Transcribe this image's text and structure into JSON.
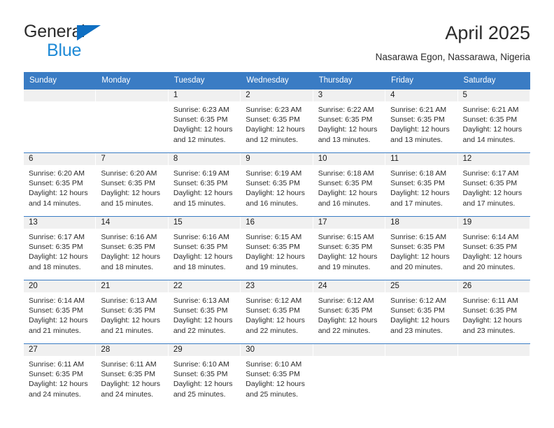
{
  "brand": {
    "name_top": "General",
    "name_bottom": "Blue",
    "accent_blue": "#1f8ad6",
    "triangle_blue": "#0f6fc2"
  },
  "header": {
    "title": "April 2025",
    "subtitle": "Nasarawa Egon, Nassarawa, Nigeria"
  },
  "theme": {
    "header_row_bg": "#3a7cc4",
    "daynum_band_bg": "#f0f0f0",
    "cell_bg": "#ffffff",
    "text": "#2b2b2b"
  },
  "weekdays": [
    "Sunday",
    "Monday",
    "Tuesday",
    "Wednesday",
    "Thursday",
    "Friday",
    "Saturday"
  ],
  "weeks": [
    [
      {
        "day": "",
        "sunrise": "",
        "sunset": "",
        "daylight_1": "",
        "daylight_2": ""
      },
      {
        "day": "",
        "sunrise": "",
        "sunset": "",
        "daylight_1": "",
        "daylight_2": ""
      },
      {
        "day": "1",
        "sunrise": "Sunrise: 6:23 AM",
        "sunset": "Sunset: 6:35 PM",
        "daylight_1": "Daylight: 12 hours",
        "daylight_2": "and 12 minutes."
      },
      {
        "day": "2",
        "sunrise": "Sunrise: 6:23 AM",
        "sunset": "Sunset: 6:35 PM",
        "daylight_1": "Daylight: 12 hours",
        "daylight_2": "and 12 minutes."
      },
      {
        "day": "3",
        "sunrise": "Sunrise: 6:22 AM",
        "sunset": "Sunset: 6:35 PM",
        "daylight_1": "Daylight: 12 hours",
        "daylight_2": "and 13 minutes."
      },
      {
        "day": "4",
        "sunrise": "Sunrise: 6:21 AM",
        "sunset": "Sunset: 6:35 PM",
        "daylight_1": "Daylight: 12 hours",
        "daylight_2": "and 13 minutes."
      },
      {
        "day": "5",
        "sunrise": "Sunrise: 6:21 AM",
        "sunset": "Sunset: 6:35 PM",
        "daylight_1": "Daylight: 12 hours",
        "daylight_2": "and 14 minutes."
      }
    ],
    [
      {
        "day": "6",
        "sunrise": "Sunrise: 6:20 AM",
        "sunset": "Sunset: 6:35 PM",
        "daylight_1": "Daylight: 12 hours",
        "daylight_2": "and 14 minutes."
      },
      {
        "day": "7",
        "sunrise": "Sunrise: 6:20 AM",
        "sunset": "Sunset: 6:35 PM",
        "daylight_1": "Daylight: 12 hours",
        "daylight_2": "and 15 minutes."
      },
      {
        "day": "8",
        "sunrise": "Sunrise: 6:19 AM",
        "sunset": "Sunset: 6:35 PM",
        "daylight_1": "Daylight: 12 hours",
        "daylight_2": "and 15 minutes."
      },
      {
        "day": "9",
        "sunrise": "Sunrise: 6:19 AM",
        "sunset": "Sunset: 6:35 PM",
        "daylight_1": "Daylight: 12 hours",
        "daylight_2": "and 16 minutes."
      },
      {
        "day": "10",
        "sunrise": "Sunrise: 6:18 AM",
        "sunset": "Sunset: 6:35 PM",
        "daylight_1": "Daylight: 12 hours",
        "daylight_2": "and 16 minutes."
      },
      {
        "day": "11",
        "sunrise": "Sunrise: 6:18 AM",
        "sunset": "Sunset: 6:35 PM",
        "daylight_1": "Daylight: 12 hours",
        "daylight_2": "and 17 minutes."
      },
      {
        "day": "12",
        "sunrise": "Sunrise: 6:17 AM",
        "sunset": "Sunset: 6:35 PM",
        "daylight_1": "Daylight: 12 hours",
        "daylight_2": "and 17 minutes."
      }
    ],
    [
      {
        "day": "13",
        "sunrise": "Sunrise: 6:17 AM",
        "sunset": "Sunset: 6:35 PM",
        "daylight_1": "Daylight: 12 hours",
        "daylight_2": "and 18 minutes."
      },
      {
        "day": "14",
        "sunrise": "Sunrise: 6:16 AM",
        "sunset": "Sunset: 6:35 PM",
        "daylight_1": "Daylight: 12 hours",
        "daylight_2": "and 18 minutes."
      },
      {
        "day": "15",
        "sunrise": "Sunrise: 6:16 AM",
        "sunset": "Sunset: 6:35 PM",
        "daylight_1": "Daylight: 12 hours",
        "daylight_2": "and 18 minutes."
      },
      {
        "day": "16",
        "sunrise": "Sunrise: 6:15 AM",
        "sunset": "Sunset: 6:35 PM",
        "daylight_1": "Daylight: 12 hours",
        "daylight_2": "and 19 minutes."
      },
      {
        "day": "17",
        "sunrise": "Sunrise: 6:15 AM",
        "sunset": "Sunset: 6:35 PM",
        "daylight_1": "Daylight: 12 hours",
        "daylight_2": "and 19 minutes."
      },
      {
        "day": "18",
        "sunrise": "Sunrise: 6:15 AM",
        "sunset": "Sunset: 6:35 PM",
        "daylight_1": "Daylight: 12 hours",
        "daylight_2": "and 20 minutes."
      },
      {
        "day": "19",
        "sunrise": "Sunrise: 6:14 AM",
        "sunset": "Sunset: 6:35 PM",
        "daylight_1": "Daylight: 12 hours",
        "daylight_2": "and 20 minutes."
      }
    ],
    [
      {
        "day": "20",
        "sunrise": "Sunrise: 6:14 AM",
        "sunset": "Sunset: 6:35 PM",
        "daylight_1": "Daylight: 12 hours",
        "daylight_2": "and 21 minutes."
      },
      {
        "day": "21",
        "sunrise": "Sunrise: 6:13 AM",
        "sunset": "Sunset: 6:35 PM",
        "daylight_1": "Daylight: 12 hours",
        "daylight_2": "and 21 minutes."
      },
      {
        "day": "22",
        "sunrise": "Sunrise: 6:13 AM",
        "sunset": "Sunset: 6:35 PM",
        "daylight_1": "Daylight: 12 hours",
        "daylight_2": "and 22 minutes."
      },
      {
        "day": "23",
        "sunrise": "Sunrise: 6:12 AM",
        "sunset": "Sunset: 6:35 PM",
        "daylight_1": "Daylight: 12 hours",
        "daylight_2": "and 22 minutes."
      },
      {
        "day": "24",
        "sunrise": "Sunrise: 6:12 AM",
        "sunset": "Sunset: 6:35 PM",
        "daylight_1": "Daylight: 12 hours",
        "daylight_2": "and 22 minutes."
      },
      {
        "day": "25",
        "sunrise": "Sunrise: 6:12 AM",
        "sunset": "Sunset: 6:35 PM",
        "daylight_1": "Daylight: 12 hours",
        "daylight_2": "and 23 minutes."
      },
      {
        "day": "26",
        "sunrise": "Sunrise: 6:11 AM",
        "sunset": "Sunset: 6:35 PM",
        "daylight_1": "Daylight: 12 hours",
        "daylight_2": "and 23 minutes."
      }
    ],
    [
      {
        "day": "27",
        "sunrise": "Sunrise: 6:11 AM",
        "sunset": "Sunset: 6:35 PM",
        "daylight_1": "Daylight: 12 hours",
        "daylight_2": "and 24 minutes."
      },
      {
        "day": "28",
        "sunrise": "Sunrise: 6:11 AM",
        "sunset": "Sunset: 6:35 PM",
        "daylight_1": "Daylight: 12 hours",
        "daylight_2": "and 24 minutes."
      },
      {
        "day": "29",
        "sunrise": "Sunrise: 6:10 AM",
        "sunset": "Sunset: 6:35 PM",
        "daylight_1": "Daylight: 12 hours",
        "daylight_2": "and 25 minutes."
      },
      {
        "day": "30",
        "sunrise": "Sunrise: 6:10 AM",
        "sunset": "Sunset: 6:35 PM",
        "daylight_1": "Daylight: 12 hours",
        "daylight_2": "and 25 minutes."
      },
      {
        "day": "",
        "sunrise": "",
        "sunset": "",
        "daylight_1": "",
        "daylight_2": ""
      },
      {
        "day": "",
        "sunrise": "",
        "sunset": "",
        "daylight_1": "",
        "daylight_2": ""
      },
      {
        "day": "",
        "sunrise": "",
        "sunset": "",
        "daylight_1": "",
        "daylight_2": ""
      }
    ]
  ]
}
